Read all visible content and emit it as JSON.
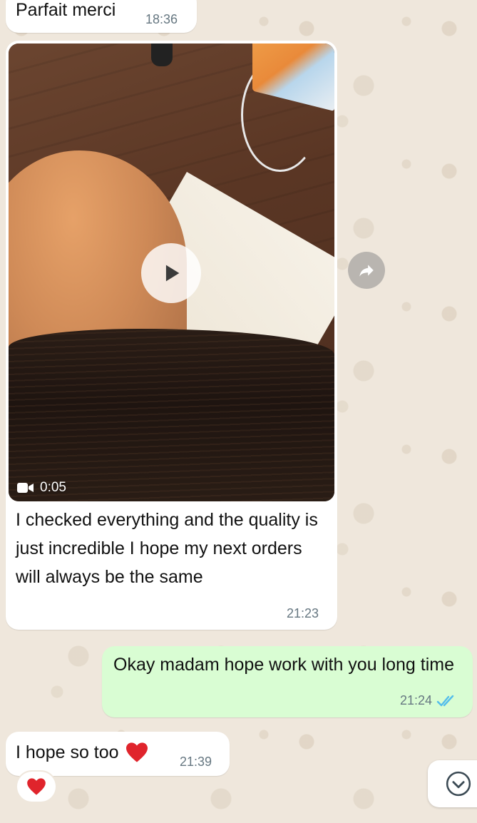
{
  "messages": [
    {
      "direction": "incoming",
      "text": "Parfait merci",
      "time": "18:36"
    },
    {
      "direction": "incoming",
      "type": "video",
      "video_duration": "0:05",
      "caption": "I checked everything and the quality is just incredible I hope my next orders will always be the same",
      "time": "21:23"
    },
    {
      "direction": "outgoing",
      "text": "Okay madam hope work with you long time",
      "time": "21:24",
      "read_status": "read"
    },
    {
      "direction": "incoming",
      "text": "I hope so too",
      "emoji": "❤️",
      "time": "21:39",
      "reaction": "❤️"
    }
  ],
  "icons": {
    "play": "play-icon",
    "video_camera": "video-camera-icon",
    "forward": "forward-icon",
    "double_check": "double-check-icon",
    "heart": "heart-icon",
    "chevron_down": "chevron-down-icon"
  },
  "colors": {
    "chat_background": "#efe7dc",
    "incoming_bubble": "#ffffff",
    "outgoing_bubble": "#d9fdd3",
    "timestamp": "#667781",
    "read_ticks": "#53bdeb",
    "heart": "#e0242c"
  }
}
